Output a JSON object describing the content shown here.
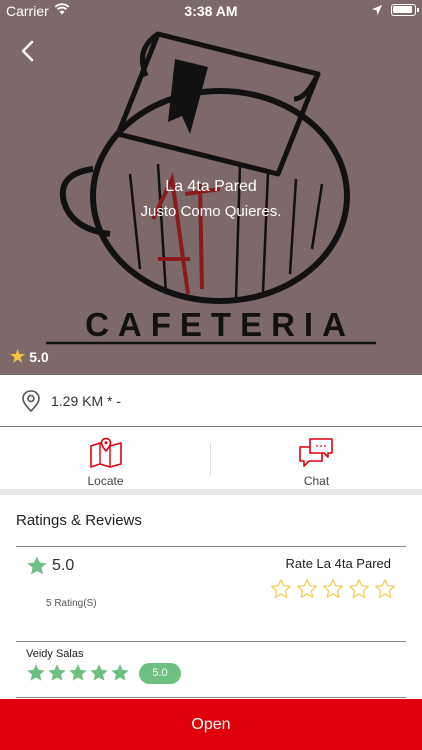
{
  "status_bar": {
    "carrier": "Carrier",
    "time": "3:38 AM"
  },
  "hero": {
    "logo_text": "CAFETERIA",
    "title": "La 4ta Pared",
    "subtitle": "Justo Como Quieres.",
    "rating": "5.0",
    "background_color": "#7d6969"
  },
  "distance": {
    "text": "1.29 KM * -"
  },
  "actions": {
    "locate_label": "Locate",
    "chat_label": "Chat"
  },
  "ratings": {
    "section_title": "Ratings & Reviews",
    "average": "5.0",
    "count_text": "5 Rating(S)",
    "rate_prompt": "Rate La 4ta Pared",
    "rate_star_count": 5
  },
  "review": {
    "author": "Veidy Salas",
    "stars": 5,
    "score": "5.0"
  },
  "open_button": {
    "label": "Open"
  },
  "colors": {
    "accent_red": "#e0000b",
    "rating_green": "#6ec081",
    "star_gold": "#f5c542",
    "star_outline": "#f2c94c"
  }
}
